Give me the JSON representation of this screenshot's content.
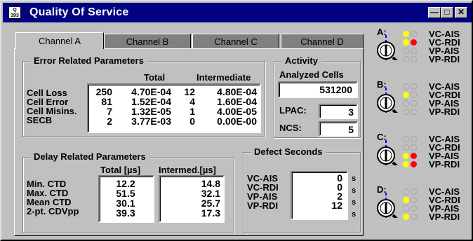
{
  "window": {
    "title": "Quality Of Service",
    "icon_text": "Q 393",
    "buttons": [
      "minimize",
      "maximize",
      "close"
    ]
  },
  "tabs": [
    "Channel A",
    "Channel B",
    "Channel C",
    "Channel D"
  ],
  "active_tab": "Channel A",
  "error_params": {
    "title": "Error Related Parameters",
    "col_total": "Total",
    "col_intermediate": "Intermediate",
    "rows": [
      {
        "label": "Cell Loss",
        "count": "250",
        "total": "4.70E-04",
        "icount": "12",
        "inter": "4.80E-04"
      },
      {
        "label": "Cell Error",
        "count": "81",
        "total": "1.52E-04",
        "icount": "4",
        "inter": "1.60E-04"
      },
      {
        "label": "Cell Misins.",
        "count": "7",
        "total": "1.32E-05",
        "icount": "1",
        "inter": "4.00E-05"
      },
      {
        "label": "SECB",
        "count": "2",
        "total": "3.77E-03",
        "icount": "0",
        "inter": "0.00E-00"
      }
    ]
  },
  "activity": {
    "title": "Activity",
    "analyzed_label": "Analyzed Cells",
    "analyzed_value": "531200",
    "lpac_label": "LPAC:",
    "lpac_value": "3",
    "ncs_label": "NCS:",
    "ncs_value": "5"
  },
  "delay_params": {
    "title": "Delay Related Parameters",
    "col_total": "Total [µs]",
    "col_intermed": "Intermed.[µs]",
    "rows": [
      {
        "label": "Min. CTD",
        "total": "12.2",
        "inter": "14.8"
      },
      {
        "label": "Max. CTD",
        "total": "51.5",
        "inter": "32.1"
      },
      {
        "label": "Mean CTD",
        "total": "30.1",
        "inter": "25.7"
      },
      {
        "label": "2-pt. CDVpp",
        "total": "39.3",
        "inter": "17.3"
      }
    ]
  },
  "defect_seconds": {
    "title": "Defect Seconds",
    "unit": "s",
    "rows": [
      {
        "label": "VC-AIS",
        "value": "0"
      },
      {
        "label": "VC-RDI",
        "value": "0"
      },
      {
        "label": "VP-AIS",
        "value": "2"
      },
      {
        "label": "VP-RDI",
        "value": "12"
      }
    ]
  },
  "channels": [
    {
      "letter": "A:",
      "signals": [
        {
          "name": "VC-AIS",
          "left": "yellow",
          "right": "off"
        },
        {
          "name": "VC-RDI",
          "left": "yellow",
          "right": "red"
        },
        {
          "name": "VP-AIS",
          "left": "off",
          "right": "off"
        },
        {
          "name": "VP-RDI",
          "left": "off",
          "right": "off"
        }
      ]
    },
    {
      "letter": "B:",
      "signals": [
        {
          "name": "VC-AIS",
          "left": "off",
          "right": "off"
        },
        {
          "name": "VC-RDI",
          "left": "yellow",
          "right": "off"
        },
        {
          "name": "VP-AIS",
          "left": "off",
          "right": "off"
        },
        {
          "name": "VP-RDI",
          "left": "off",
          "right": "off"
        }
      ]
    },
    {
      "letter": "C:",
      "signals": [
        {
          "name": "VC-AIS",
          "left": "off",
          "right": "off"
        },
        {
          "name": "VC-RDI",
          "left": "off",
          "right": "off"
        },
        {
          "name": "VP-AIS",
          "left": "yellow",
          "right": "red"
        },
        {
          "name": "VP-RDI",
          "left": "yellow",
          "right": "red"
        }
      ]
    },
    {
      "letter": "D:",
      "signals": [
        {
          "name": "VC-AIS",
          "left": "off",
          "right": "off"
        },
        {
          "name": "VC-RDI",
          "left": "yellow",
          "right": "off"
        },
        {
          "name": "VP-AIS",
          "left": "off",
          "right": "off"
        },
        {
          "name": "VP-RDI",
          "left": "yellow",
          "right": "off"
        }
      ]
    }
  ],
  "colors": {
    "titlebar": "#000080",
    "face": "#c0c0c0",
    "led_yellow": "#ffff00",
    "led_red": "#ff0000",
    "probe_dash": "#0000ff"
  }
}
